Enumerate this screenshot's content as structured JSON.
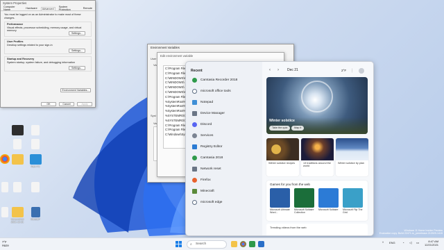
{
  "system_properties": {
    "title": "System Properties",
    "tabs": [
      "Computer Name",
      "Hardware",
      "Advanced",
      "System Protection",
      "Remote"
    ],
    "intro": "You must be logged on as an Administrator to make most of these changes.",
    "performance": {
      "title": "Performance",
      "desc": "Visual effects, processor scheduling, memory usage, and virtual memory",
      "button": "Settings..."
    },
    "user_profiles": {
      "title": "User Profiles",
      "desc": "Desktop settings related to your sign-in",
      "button": "Settings..."
    },
    "startup": {
      "title": "Startup and Recovery",
      "desc": "System startup, system failure, and debugging information",
      "button": "Settings..."
    },
    "env_button": "Environment Variables...",
    "ok": "OK",
    "cancel": "Cancel",
    "apply": "Apply"
  },
  "env_vars": {
    "title": "Environment Variables",
    "user_label": "User",
    "var_label": "Vari",
    "sys_label": "Syst",
    "sys_var_label": "Vari"
  },
  "edit_env": {
    "title": "Edit environment variable",
    "paths": [
      "C:\\Program Files",
      "C:\\Program Files",
      "C:\\WINDOWS\\s",
      "C:\\WINDOWS\\",
      "C:\\WINDOWS\\",
      "C:\\WINDOWS\\s",
      "C:\\Program Files",
      "%SystemRoot%",
      "%SystemRoot%",
      "%SystemRoot%",
      "%SYSTEMROOT%",
      "%SYSTEMROOT%",
      "C:\\Program Files",
      "C:\\Program Files",
      "C:\\Windows\\Sys"
    ]
  },
  "desktop_icons": [
    {
      "label": ""
    },
    {
      "label": ""
    },
    {
      "label": ""
    },
    {
      "label": ""
    },
    {
      "label": ""
    },
    {
      "label": ""
    },
    {
      "label": ""
    },
    {
      "label": "Web PC"
    },
    {
      "label": ""
    },
    {
      "label": ""
    },
    {
      "label": ""
    },
    {
      "label": "Screenshot 2021-12-21"
    },
    {
      "label": "WinSCP"
    }
  ],
  "start_menu": {
    "recent_header": "Recent",
    "items": [
      {
        "label": "Camtasia Recorder 2018",
        "color": "#2f9a4b"
      },
      {
        "label": "microsoft office tools",
        "color": "#5a6b80"
      },
      {
        "label": "Notepad",
        "color": "#3f8fd6"
      },
      {
        "label": "Device Manager",
        "color": "#6a7585"
      },
      {
        "label": "Discord",
        "color": "#5865f2"
      },
      {
        "label": "Services",
        "color": "#7b8492"
      },
      {
        "label": "Registry Editor",
        "color": "#2b7bd3"
      },
      {
        "label": "Camtasia 2018",
        "color": "#2f9a4b"
      },
      {
        "label": "Network reset",
        "color": "#6a7585"
      },
      {
        "label": "Firefox",
        "color": "#e8622d"
      },
      {
        "label": "Minecraft",
        "color": "#5b8a3a"
      },
      {
        "label": "microsoft edge",
        "color": "#1a8fd0"
      }
    ]
  },
  "widgets": {
    "date": "Dec 21",
    "temp": "2°F",
    "hero_title": "Winter solstice",
    "take_quiz": "Take the quiz",
    "map_it": "Map it",
    "cards": [
      {
        "title": "Winter solstice recipes"
      },
      {
        "title": "13 traditions around the world"
      },
      {
        "title": "Winter solstice by plan"
      }
    ],
    "games_header": "Games for you from the web",
    "games": [
      {
        "title": "Microsoft Ultimate Word..."
      },
      {
        "title": "Microsoft Solitaire Collection"
      },
      {
        "title": "Microsoft Solitaire"
      },
      {
        "title": "Microsoft Flip The Grid"
      }
    ],
    "trending": "Trending videos from the web"
  },
  "taskbar": {
    "weather_temp": "7°F",
    "weather_desc": "Haze",
    "search_placeholder": "Search",
    "lang": "ENG",
    "time": "8:47 AM",
    "date": "12/21/2021"
  },
  "watermark": {
    "line1": "Windows 11 Home Insider Preview",
    "line2": "Evaluation copy. Build 22471.rs_prerelease.210929-1415"
  }
}
